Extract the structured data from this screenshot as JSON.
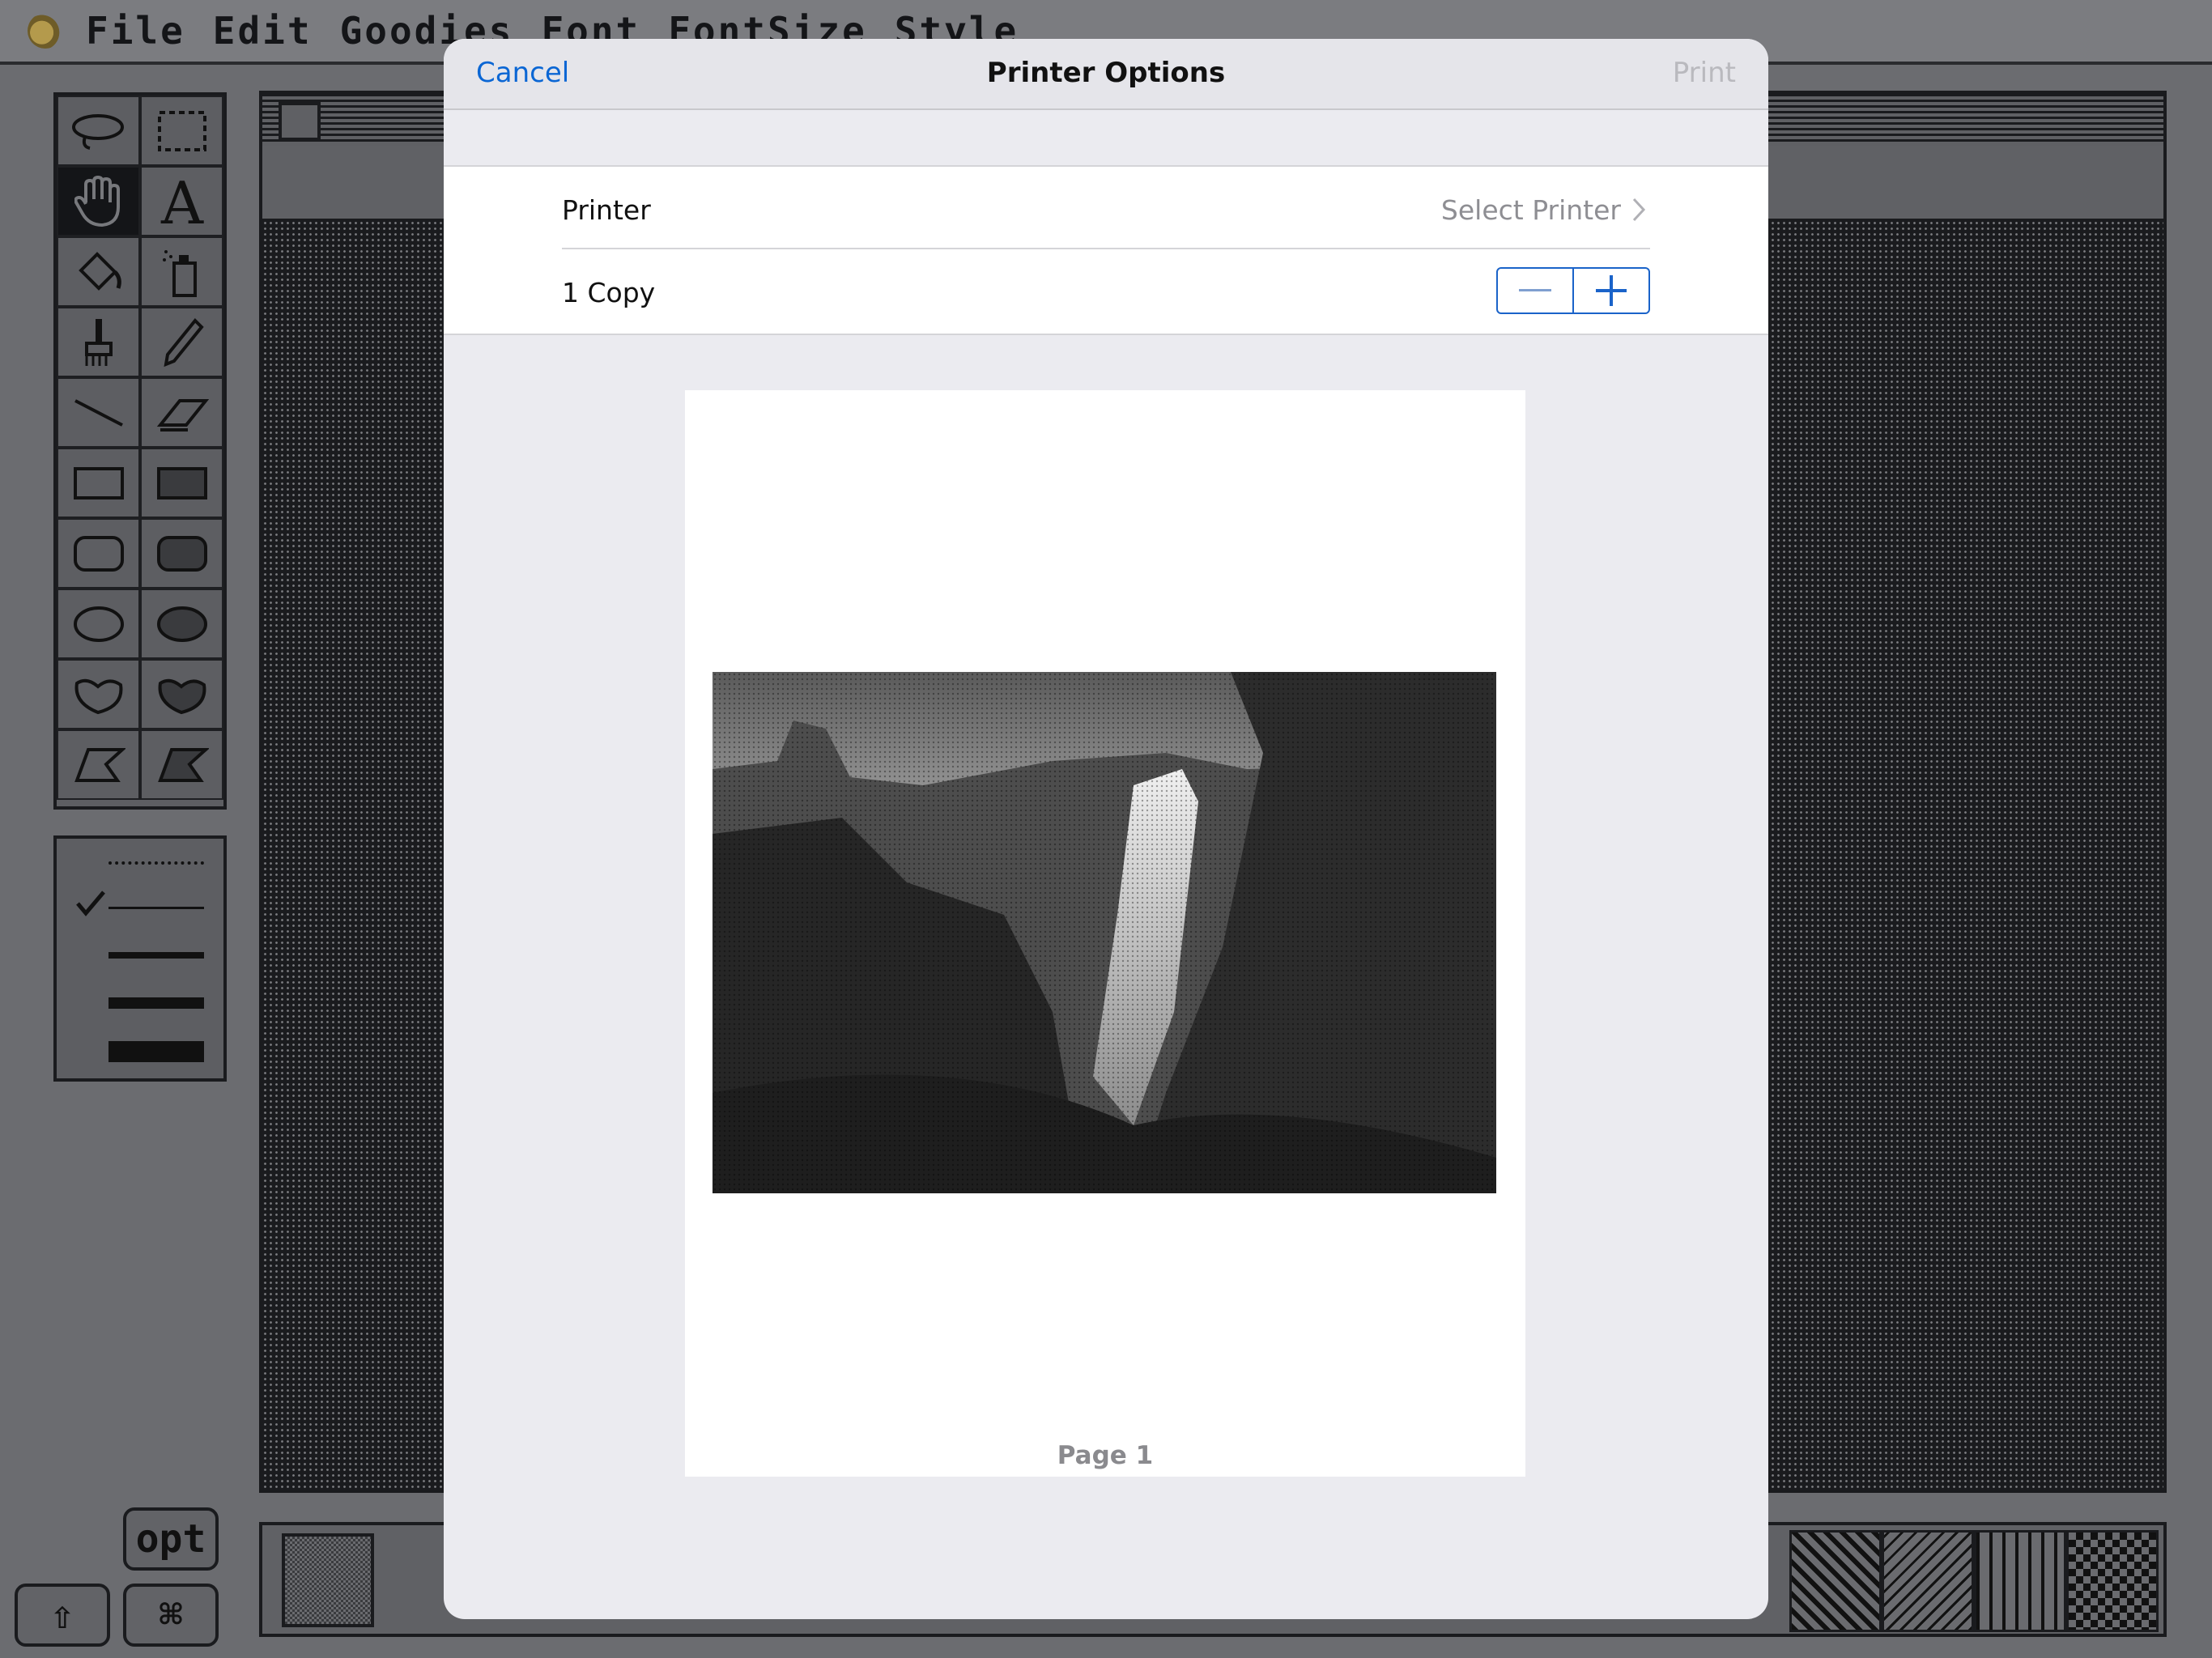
{
  "app": {
    "menu": [
      "File",
      "Edit",
      "Goodies",
      "Font",
      "FontSize",
      "Style"
    ],
    "keys": {
      "opt": "opt",
      "shift": "⇧",
      "command": "⌘"
    }
  },
  "dialog": {
    "title": "Printer Options",
    "cancel_label": "Cancel",
    "print_label": "Print",
    "printer_label": "Printer",
    "printer_value": "Select Printer",
    "copies_label": "1 Copy",
    "page_label": "Page 1"
  },
  "colors": {
    "accent": "#0a66d4",
    "disabled": "#b9b9be",
    "sheet_background": "#ebebf0"
  },
  "icons": {
    "tools": [
      "lasso-icon",
      "marquee-select-icon",
      "grabber-hand-icon",
      "text-tool-icon",
      "paint-bucket-icon",
      "spray-can-icon",
      "paintbrush-icon",
      "pencil-icon",
      "line-tool-icon",
      "eraser-icon",
      "rectangle-icon",
      "filled-rectangle-icon",
      "rounded-rectangle-icon",
      "filled-rounded-rectangle-icon",
      "oval-icon",
      "filled-oval-icon",
      "freeform-shape-icon",
      "filled-freeform-shape-icon",
      "polygon-icon",
      "filled-polygon-icon"
    ],
    "chevron": "chevron-right-icon",
    "minus": "minus-icon",
    "plus": "plus-icon"
  }
}
